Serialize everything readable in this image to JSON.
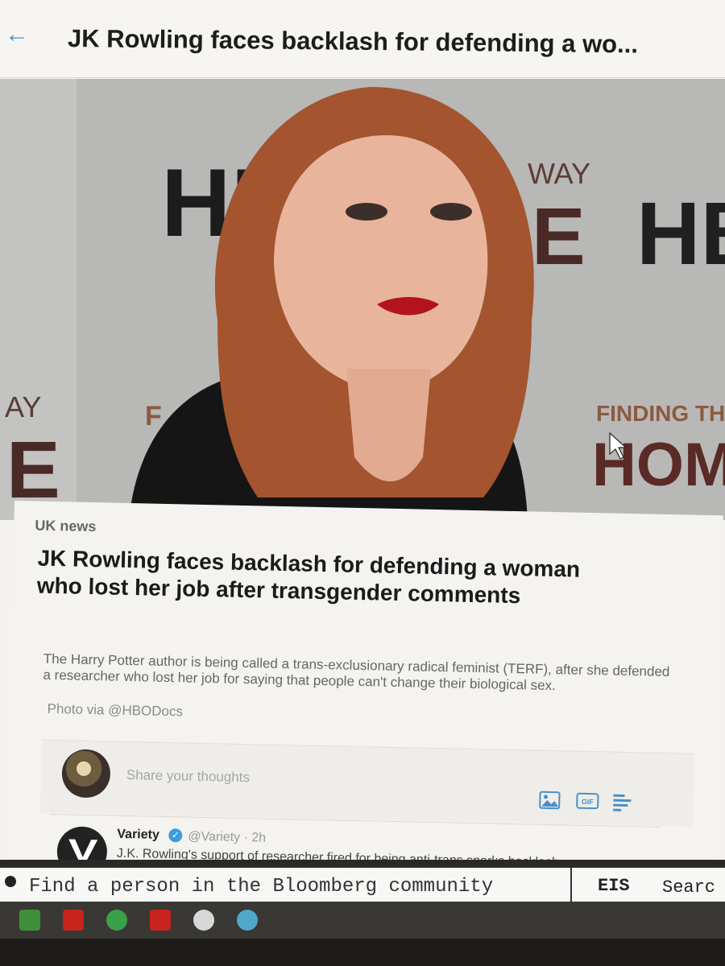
{
  "topbar": {
    "title": "JK Rowling faces backlash for defending a wo...",
    "back_icon": "arrow-left-icon"
  },
  "hero": {
    "backdrop_text": {
      "hbo_left": "HB",
      "way": "WAY",
      "e_right": "E",
      "hbo_right": "HBO",
      "ay_left": "AY",
      "e_left": "E",
      "f": "F",
      "finding": "FINDING THE W",
      "home": "HOME"
    }
  },
  "article": {
    "category": "UK news",
    "headline": "JK Rowling faces backlash for defending a woman who lost her job after transgender comments",
    "summary": "The Harry Potter author is being called a trans-exclusionary radical feminist (TERF), after she defended a researcher who lost her job for saying that people can't change their biological sex.",
    "credit": "Photo via @HBODocs"
  },
  "composer": {
    "placeholder": "Share your thoughts",
    "gif_label": "GIF"
  },
  "tweet": {
    "name": "Variety",
    "handle": "@Variety · 2h",
    "text": "J.K. Rowling's support of researcher fired for being anti-trans sparks backlash"
  },
  "bloomberg": {
    "placeholder": "Find a person in the Bloomberg community",
    "eis": "EIS",
    "search": "Searc"
  },
  "colors": {
    "accent": "#4a90c8",
    "verified": "#3d9be0",
    "hero_bg": "#b9b9b7"
  }
}
